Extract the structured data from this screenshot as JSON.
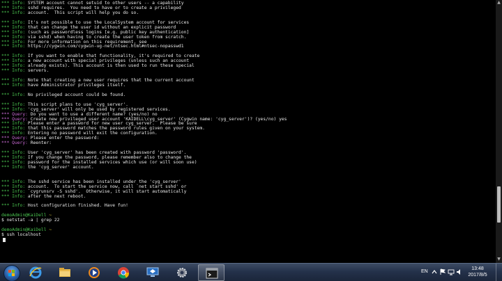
{
  "terminal": {
    "lines": [
      {
        "prefix": "*** Info:",
        "kind": "info",
        "text": " SYSTEM account cannot setuid to other users -- a capability"
      },
      {
        "prefix": "*** Info:",
        "kind": "info",
        "text": " sshd requires.  You need to have or to create a privileged"
      },
      {
        "prefix": "*** Info:",
        "kind": "info",
        "text": " account.  This script will help you do so."
      },
      {
        "prefix": "",
        "kind": "blank",
        "text": ""
      },
      {
        "prefix": "*** Info:",
        "kind": "info",
        "text": " It's not possible to use the LocalSystem account for services"
      },
      {
        "prefix": "*** Info:",
        "kind": "info",
        "text": " that can change the user id without an explicit password"
      },
      {
        "prefix": "*** Info:",
        "kind": "info",
        "text": " (such as passwordless logins [e.g. public key authentication]"
      },
      {
        "prefix": "*** Info:",
        "kind": "info",
        "text": " via sshd) when having to create the user token from scratch."
      },
      {
        "prefix": "*** Info:",
        "kind": "info",
        "text": " For more information on this requirement, see"
      },
      {
        "prefix": "*** Info:",
        "kind": "info",
        "text": " https://cygwin.com/cygwin-ug-net/ntsec.html#ntsec-nopasswd1"
      },
      {
        "prefix": "",
        "kind": "blank",
        "text": ""
      },
      {
        "prefix": "*** Info:",
        "kind": "info",
        "text": " If you want to enable that functionality, it's required to create"
      },
      {
        "prefix": "*** Info:",
        "kind": "info",
        "text": " a new account with special privileges (unless such an account"
      },
      {
        "prefix": "*** Info:",
        "kind": "info",
        "text": " already exists). This account is then used to run these special"
      },
      {
        "prefix": "*** Info:",
        "kind": "info",
        "text": " servers."
      },
      {
        "prefix": "",
        "kind": "blank",
        "text": ""
      },
      {
        "prefix": "*** Info:",
        "kind": "info",
        "text": " Note that creating a new user requires that the current account"
      },
      {
        "prefix": "*** Info:",
        "kind": "info",
        "text": " have Administrator privileges itself."
      },
      {
        "prefix": "",
        "kind": "blank",
        "text": ""
      },
      {
        "prefix": "*** Info:",
        "kind": "info",
        "text": " No privileged account could be found."
      },
      {
        "prefix": "",
        "kind": "blank",
        "text": ""
      },
      {
        "prefix": "*** Info:",
        "kind": "info",
        "text": " This script plans to use 'cyg_server'."
      },
      {
        "prefix": "*** Info:",
        "kind": "info",
        "text": " 'cyg_server' will only be used by registered services."
      },
      {
        "prefix": "*** Query:",
        "kind": "query",
        "text": " Do you want to use a different name? (yes/no) no"
      },
      {
        "prefix": "*** Query:",
        "kind": "query",
        "text": " Create new privileged user account 'KAIDELL\\cyg_server' (Cygwin name: 'cyg_server')? (yes/no) yes"
      },
      {
        "prefix": "*** Info:",
        "kind": "info",
        "text": " Please enter a password for new user cyg_server.  Please be sure"
      },
      {
        "prefix": "*** Info:",
        "kind": "info",
        "text": " that this password matches the password rules given on your system."
      },
      {
        "prefix": "*** Info:",
        "kind": "info",
        "text": " Entering no password will exit the configuration."
      },
      {
        "prefix": "*** Query:",
        "kind": "query",
        "text": " Please enter the password:"
      },
      {
        "prefix": "*** Query:",
        "kind": "query",
        "text": " Reenter:"
      },
      {
        "prefix": "",
        "kind": "blank",
        "text": ""
      },
      {
        "prefix": "*** Info:",
        "kind": "info",
        "text": " User 'cyg_server' has been created with password 'password'."
      },
      {
        "prefix": "*** Info:",
        "kind": "info",
        "text": " If you change the password, please remember also to change the"
      },
      {
        "prefix": "*** Info:",
        "kind": "info",
        "text": " password for the installed services which use (or will soon use)"
      },
      {
        "prefix": "*** Info:",
        "kind": "info",
        "text": " the 'cyg_server' account."
      },
      {
        "prefix": "",
        "kind": "blank",
        "text": ""
      },
      {
        "prefix": "",
        "kind": "blank",
        "text": ""
      },
      {
        "prefix": "*** Info:",
        "kind": "info",
        "text": " The sshd service has been installed under the 'cyg_server'"
      },
      {
        "prefix": "*** Info:",
        "kind": "info",
        "text": " account.  To start the service now, call `net start sshd' or"
      },
      {
        "prefix": "*** Info:",
        "kind": "info",
        "text": " `cygrunsrv -S sshd'.  Otherwise, it will start automatically"
      },
      {
        "prefix": "*** Info:",
        "kind": "info",
        "text": " after the next reboot."
      },
      {
        "prefix": "",
        "kind": "blank",
        "text": ""
      },
      {
        "prefix": "*** Info:",
        "kind": "info",
        "text": " Host configuration finished. Have fun!"
      },
      {
        "prefix": "",
        "kind": "blank",
        "text": ""
      },
      {
        "prefix": "demoAdmin@KaiDell",
        "kind": "prompt",
        "text": " ~"
      },
      {
        "prefix": "",
        "kind": "cmd",
        "text": "$ netstat -a | grep 22"
      },
      {
        "prefix": "",
        "kind": "blank",
        "text": ""
      },
      {
        "prefix": "demoAdmin@KaiDell",
        "kind": "prompt",
        "text": " ~"
      },
      {
        "prefix": "",
        "kind": "cmd",
        "text": "$ ssh localhost"
      },
      {
        "prefix": "",
        "kind": "cursor",
        "text": ""
      }
    ],
    "scroll_position_fraction": 0.84
  },
  "taskbar": {
    "pinned": [
      {
        "name": "ie-icon",
        "active": false
      },
      {
        "name": "file-explorer-icon",
        "active": false
      },
      {
        "name": "media-player-icon",
        "active": false
      },
      {
        "name": "chrome-icon",
        "active": false
      },
      {
        "name": "remote-desktop-icon",
        "active": false
      },
      {
        "name": "settings-gear-icon",
        "active": false
      },
      {
        "name": "cygwin-terminal-icon",
        "active": true
      }
    ],
    "tray": {
      "language": "EN",
      "time": "13:48",
      "date": "2017/8/5"
    }
  },
  "colors": {
    "info": "#49c24e",
    "query": "#c86ad3",
    "prompt_cwd": "#d1c43a",
    "taskbar": "#24314a"
  }
}
